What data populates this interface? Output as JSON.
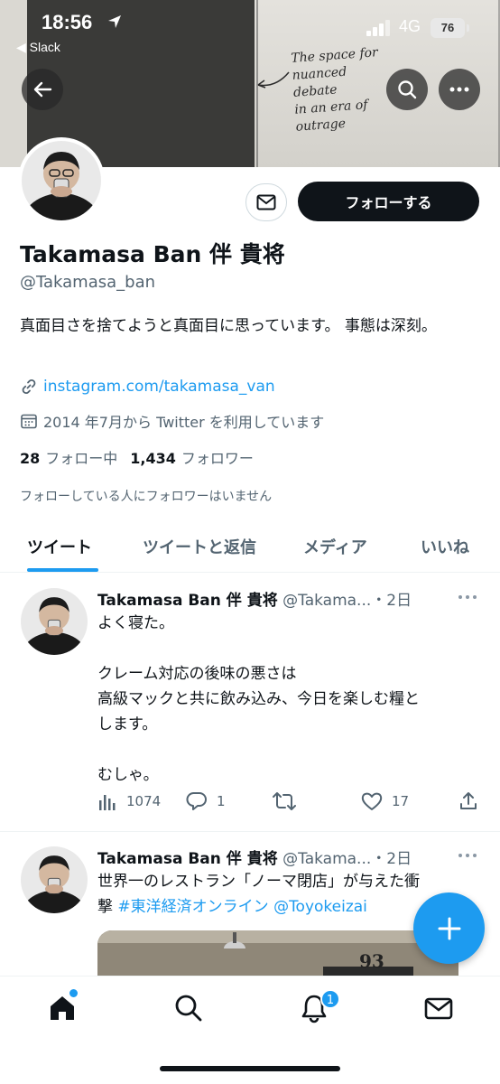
{
  "status_bar": {
    "time": "18:56",
    "back_app": "◀ Slack",
    "network": "4G",
    "battery": "76"
  },
  "banner": {
    "handwriting": [
      "The space for",
      "nuanced debate",
      "in an era of",
      "outrage"
    ]
  },
  "profile": {
    "follow_label": "フォローする",
    "display_name": "Takamasa Ban 伴 貴将",
    "handle": "@Takamasa_ban",
    "bio": "真面目さを捨てようと真面目に思っています。 事態は深刻。",
    "link": "instagram.com/takamasa_van",
    "joined": "2014 年7月から Twitter を利用しています",
    "following_count": "28",
    "following_label": "フォロー中",
    "followers_count": "1,434",
    "followers_label": "フォロワー",
    "followers_note": "フォローしている人にフォロワーはいません"
  },
  "tabs": [
    "ツイート",
    "ツイートと返信",
    "メディア",
    "いいね"
  ],
  "tweets": [
    {
      "name": "Takamasa Ban 伴 貴将",
      "handle": "@Takama...",
      "time": "・2日",
      "lines": [
        "よく寝た。",
        "",
        "クレーム対応の後味の悪さは",
        "高級マックと共に飲み込み、今日を楽しむ糧と",
        "します。",
        "",
        "むしゃ。"
      ],
      "views": "1074",
      "replies": "1",
      "retweets": "",
      "likes": "17"
    },
    {
      "name": "Takamasa Ban 伴 貴将",
      "handle": "@Takama...",
      "time": "・2日",
      "line1": "世界一のレストラン「ノーマ閉店」が与えた衝",
      "line2_prefix": "撃 ",
      "hashtag": "#東洋経済オンライン",
      "mention": "@Toyokeizai",
      "card_number": "93"
    }
  ],
  "bottom_nav": {
    "notification_count": "1"
  },
  "colors": {
    "accent": "#1d9bf0",
    "text": "#0f1419",
    "muted": "#536471"
  }
}
